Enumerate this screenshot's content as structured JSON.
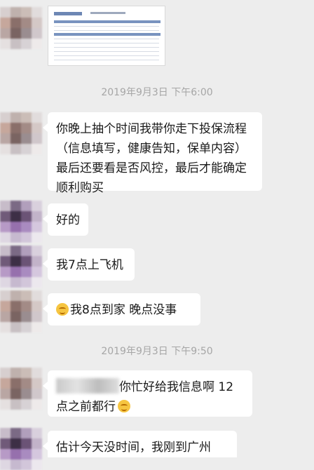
{
  "timestamps": [
    "2019年9月3日 下午6:00",
    "2019年9月3日 下午9:50"
  ],
  "messages": [
    {
      "text": "你晚上抽个时间我带你走下投保流程（信息填写，健康告知，保单内容）最后还要看是否风控，最后才能确定顺利购买"
    },
    {
      "text": "好的"
    },
    {
      "text": "我7点上飞机"
    },
    {
      "text": "我8点到家  晚点没事"
    },
    {
      "text": "你忙好给我信息啊  12点之前都行"
    },
    {
      "text": "估计今天没时间，我刚到广州"
    }
  ],
  "icons": {
    "emoji": "smiley-emoji-icon"
  },
  "colors": {
    "background": "#ededed",
    "bubble": "#ffffff",
    "timestamp": "#a6a6a6"
  }
}
